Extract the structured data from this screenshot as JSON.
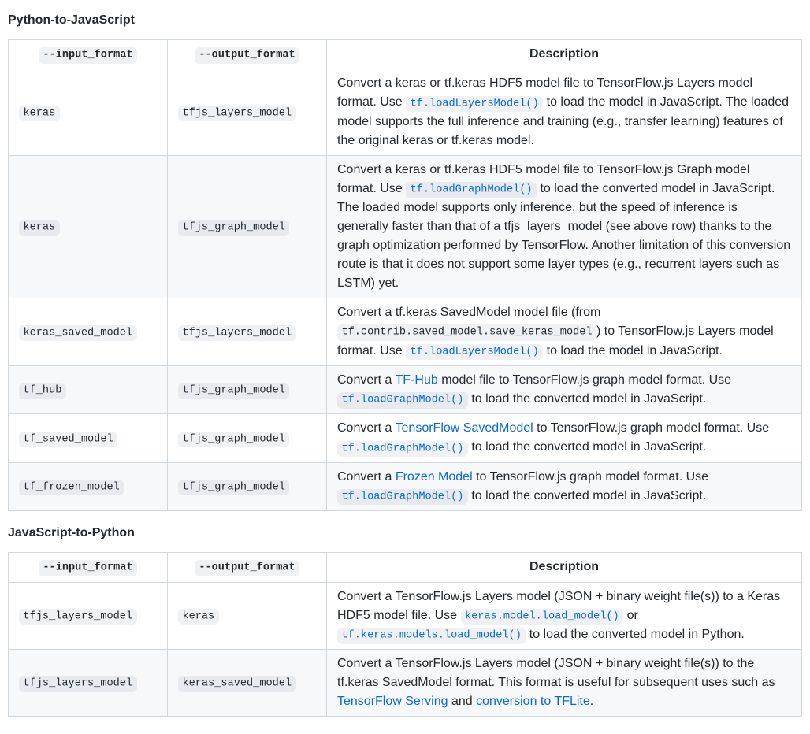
{
  "section1": {
    "title": "Python-to-JavaScript",
    "headers": {
      "in": "--input_format",
      "out": "--output_format",
      "desc": "Description"
    },
    "rows": [
      {
        "in": "keras",
        "out": "tfjs_layers_model",
        "desc": [
          {
            "t": "text",
            "v": "Convert a keras or tf.keras HDF5 model file to TensorFlow.js Layers model format. Use "
          },
          {
            "t": "codelink",
            "v": "tf.loadLayersModel()"
          },
          {
            "t": "text",
            "v": " to load the model in JavaScript. The loaded model supports the full inference and training (e.g., transfer learning) features of the original keras or tf.keras model."
          }
        ]
      },
      {
        "in": "keras",
        "out": "tfjs_graph_model",
        "desc": [
          {
            "t": "text",
            "v": "Convert a keras or tf.keras HDF5 model file to TensorFlow.js Graph model format. Use "
          },
          {
            "t": "codelink",
            "v": "tf.loadGraphModel()"
          },
          {
            "t": "text",
            "v": " to load the converted model in JavaScript. The loaded model supports only inference, but the speed of inference is generally faster than that of a tfjs_layers_model (see above row) thanks to the graph optimization performed by TensorFlow. Another limitation of this conversion route is that it does not support some layer types (e.g., recurrent layers such as LSTM) yet."
          }
        ]
      },
      {
        "in": "keras_saved_model",
        "out": "tfjs_layers_model",
        "desc": [
          {
            "t": "text",
            "v": "Convert a tf.keras SavedModel model file (from "
          },
          {
            "t": "code",
            "v": "tf.contrib.saved_model.save_keras_model"
          },
          {
            "t": "text",
            "v": ") to TensorFlow.js Layers model format. Use "
          },
          {
            "t": "codelink",
            "v": "tf.loadLayersModel()"
          },
          {
            "t": "text",
            "v": " to load the model in JavaScript."
          }
        ]
      },
      {
        "in": "tf_hub",
        "out": "tfjs_graph_model",
        "desc": [
          {
            "t": "text",
            "v": "Convert a "
          },
          {
            "t": "link",
            "v": "TF-Hub"
          },
          {
            "t": "text",
            "v": " model file to TensorFlow.js graph model format. Use "
          },
          {
            "t": "codelink",
            "v": "tf.loadGraphModel()"
          },
          {
            "t": "text",
            "v": " to load the converted model in JavaScript."
          }
        ]
      },
      {
        "in": "tf_saved_model",
        "out": "tfjs_graph_model",
        "desc": [
          {
            "t": "text",
            "v": "Convert a "
          },
          {
            "t": "link",
            "v": "TensorFlow SavedModel"
          },
          {
            "t": "text",
            "v": " to TensorFlow.js graph model format. Use "
          },
          {
            "t": "codelink",
            "v": "tf.loadGraphModel()"
          },
          {
            "t": "text",
            "v": " to load the converted model in JavaScript."
          }
        ]
      },
      {
        "in": "tf_frozen_model",
        "out": "tfjs_graph_model",
        "desc": [
          {
            "t": "text",
            "v": "Convert a "
          },
          {
            "t": "link",
            "v": "Frozen Model"
          },
          {
            "t": "text",
            "v": " to TensorFlow.js graph model format. Use "
          },
          {
            "t": "codelink",
            "v": "tf.loadGraphModel()"
          },
          {
            "t": "text",
            "v": " to load the converted model in JavaScript."
          }
        ]
      }
    ]
  },
  "section2": {
    "title": "JavaScript-to-Python",
    "headers": {
      "in": "--input_format",
      "out": "--output_format",
      "desc": "Description"
    },
    "rows": [
      {
        "in": "tfjs_layers_model",
        "out": "keras",
        "desc": [
          {
            "t": "text",
            "v": "Convert a TensorFlow.js Layers model (JSON + binary weight file(s)) to a Keras HDF5 model file. Use "
          },
          {
            "t": "codelink",
            "v": "keras.model.load_model()"
          },
          {
            "t": "text",
            "v": " or "
          },
          {
            "t": "codelink",
            "v": "tf.keras.models.load_model()"
          },
          {
            "t": "text",
            "v": " to load the converted model in Python."
          }
        ]
      },
      {
        "in": "tfjs_layers_model",
        "out": "keras_saved_model",
        "desc": [
          {
            "t": "text",
            "v": "Convert a TensorFlow.js Layers model (JSON + binary weight file(s)) to the tf.keras SavedModel format. This format is useful for subsequent uses such as "
          },
          {
            "t": "link",
            "v": "TensorFlow Serving"
          },
          {
            "t": "text",
            "v": " and "
          },
          {
            "t": "link",
            "v": "conversion to TFLite"
          },
          {
            "t": "text",
            "v": "."
          }
        ]
      }
    ]
  }
}
